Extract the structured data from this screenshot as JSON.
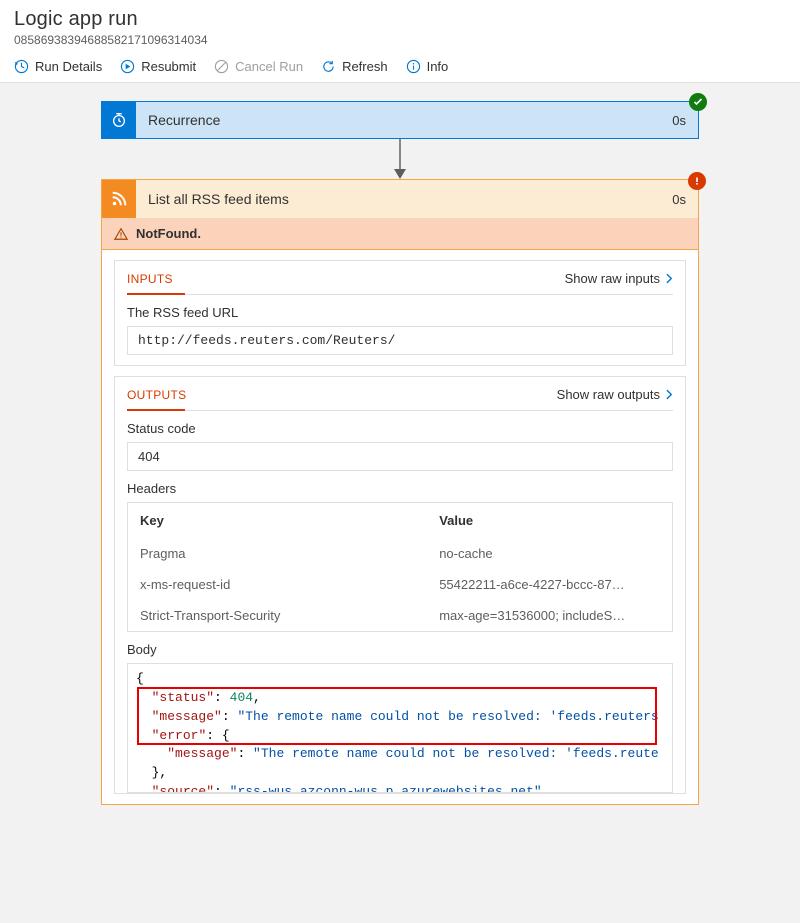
{
  "header": {
    "title": "Logic app run",
    "run_id": "08586938394688582171096314034"
  },
  "toolbar": {
    "run_details": "Run Details",
    "resubmit": "Resubmit",
    "cancel": "Cancel Run",
    "refresh": "Refresh",
    "info": "Info"
  },
  "recurrence": {
    "title": "Recurrence",
    "duration": "0s"
  },
  "rss": {
    "title": "List all RSS feed items",
    "duration": "0s",
    "error_status": "NotFound."
  },
  "inputs": {
    "label": "INPUTS",
    "raw_link": "Show raw inputs",
    "field_label": "The RSS feed URL",
    "field_value": "http://feeds.reuters.com/Reuters/"
  },
  "outputs": {
    "label": "OUTPUTS",
    "raw_link": "Show raw outputs",
    "status_label": "Status code",
    "status_value": "404",
    "headers_label": "Headers",
    "headers_col_key": "Key",
    "headers_col_val": "Value",
    "headers": [
      {
        "k": "Pragma",
        "v": "no-cache"
      },
      {
        "k": "x-ms-request-id",
        "v": "55422211-a6ce-4227-bccc-87…"
      },
      {
        "k": "Strict-Transport-Security",
        "v": "max-age=31536000; includeS…"
      }
    ],
    "body_label": "Body",
    "body_json": {
      "status": 404,
      "message": "The remote name could not be resolved: 'feeds.reuters",
      "error_key": "error",
      "inner_message": "The remote name could not be resolved: 'feeds.reute",
      "source": "rss-wus.azconn-wus.p.azurewebsites.net"
    }
  }
}
